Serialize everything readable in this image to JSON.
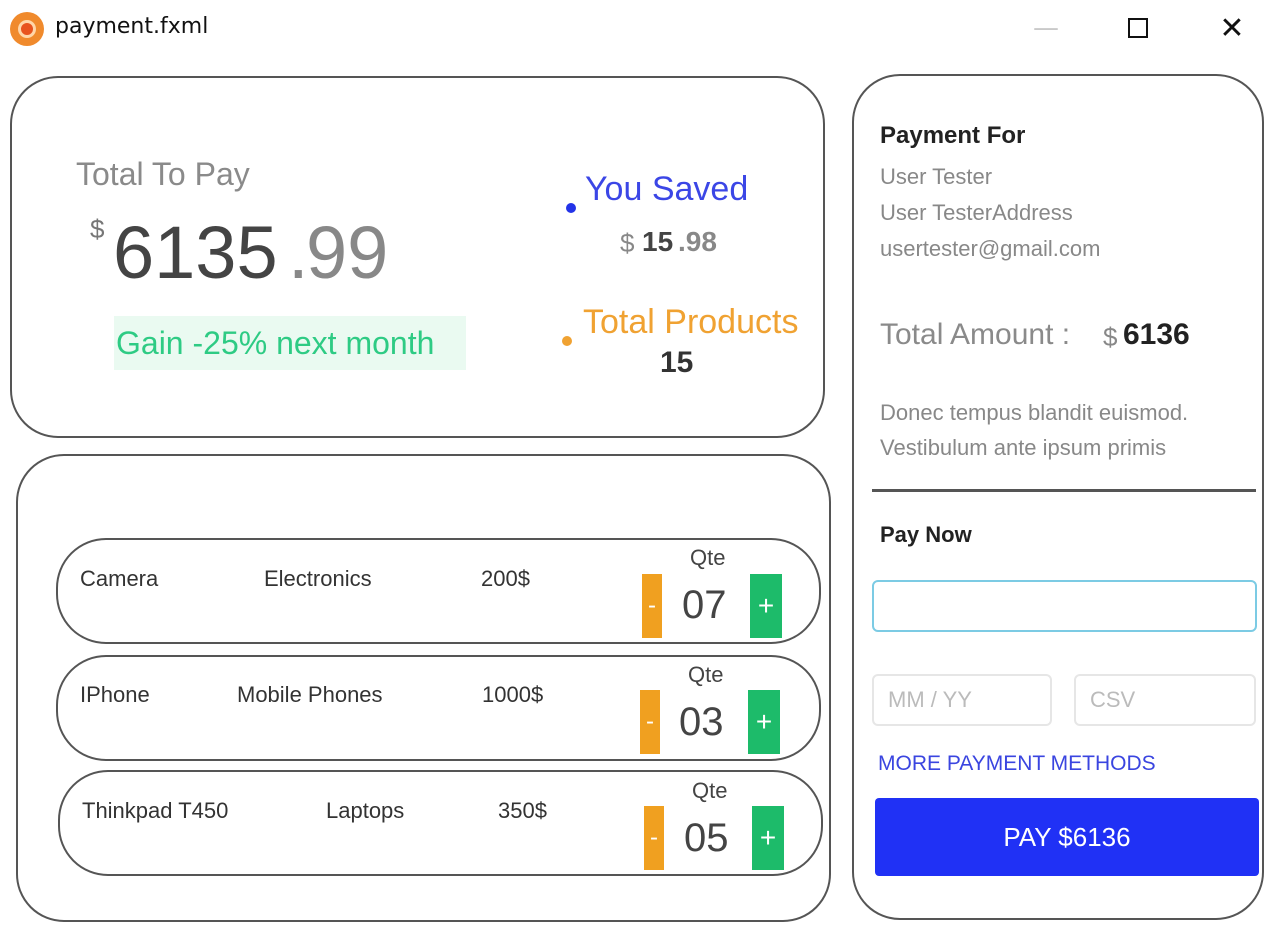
{
  "window": {
    "title": "payment.fxml",
    "minimize": "—",
    "close": "✕"
  },
  "summary": {
    "total_label": "Total To Pay",
    "currency": "$",
    "amount_integer": "6135",
    "amount_sep": ".",
    "amount_decimal": "99",
    "gain_text": "Gain -25% next month",
    "saved_label": "You Saved",
    "saved_currency": "$",
    "saved_integer": "15",
    "saved_decimal": ".98",
    "products_label": "Total Products",
    "products_count": "15"
  },
  "items": [
    {
      "name": "Camera",
      "category": "Electronics",
      "price": "200$",
      "qte_label": "Qte",
      "qty": "07",
      "minus": "-",
      "plus": "+"
    },
    {
      "name": "IPhone",
      "category": "Mobile Phones",
      "price": "1000$",
      "qte_label": "Qte",
      "qty": "03",
      "minus": "-",
      "plus": "+"
    },
    {
      "name": "Thinkpad T450",
      "category": "Laptops",
      "price": "350$",
      "qte_label": "Qte",
      "qty": "05",
      "minus": "-",
      "plus": "+"
    }
  ],
  "payment": {
    "title": "Payment For",
    "user_name": "User Tester",
    "user_address": "User TesterAddress",
    "user_email": "usertester@gmail.com",
    "total_amount_label": "Total Amount :",
    "total_amount_currency": "$",
    "total_amount_value": "6136",
    "description_line1": "Donec tempus blandit euismod.",
    "description_line2": "Vestibulum ante ipsum primis",
    "pay_now_title": "Pay Now",
    "card_number_value": "",
    "expiry_placeholder": "MM / YY",
    "csv_placeholder": "CSV",
    "more_methods": "MORE PAYMENT METHODS",
    "pay_button": "PAY $6136"
  },
  "colors": {
    "accent_blue": "#2031f5",
    "saved_blue": "#3b46e6",
    "orange": "#f0a232",
    "green": "#1dbb6a",
    "gain_green": "#2ecb84"
  },
  "icons": {
    "app": "app-logo-icon",
    "minimize": "minimize-icon",
    "maximize": "maximize-icon",
    "close": "close-icon"
  }
}
